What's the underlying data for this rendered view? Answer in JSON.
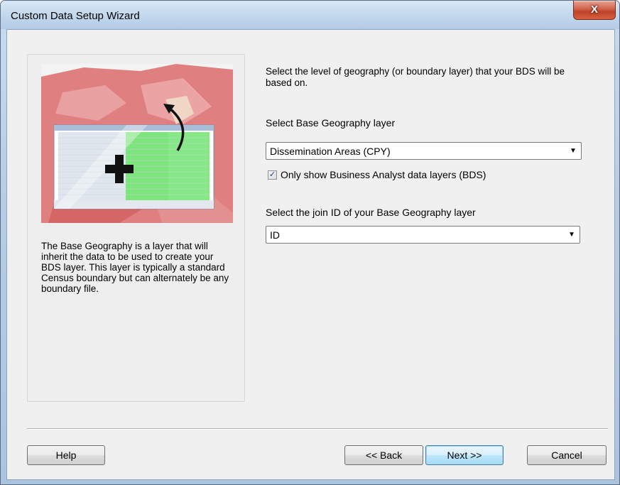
{
  "window": {
    "title": "Custom Data Setup Wizard",
    "close_label": "X"
  },
  "left_panel": {
    "description": "The Base Geography is a layer that will inherit the data to be used to create your BDS layer. This layer is typically a standard Census boundary but can alternately be any boundary file."
  },
  "main": {
    "intro": "Select the level of geography (or boundary layer) that your BDS will be based on.",
    "base_geography_label": "Select Base Geography layer",
    "base_geography_value": "Dissemination Areas (CPY)",
    "only_bds_label": "Only show Business Analyst data layers (BDS)",
    "only_bds_checked": true,
    "join_id_label": "Select the join ID of your Base Geography layer",
    "join_id_value": "ID"
  },
  "buttons": {
    "help": "Help",
    "back": "<< Back",
    "next": "Next >>",
    "cancel": "Cancel"
  },
  "icons": {
    "dropdown": "chevron-down-icon",
    "checkmark": "checkmark-icon",
    "close": "close-icon"
  },
  "colors": {
    "close_button": "#c0422a",
    "default_button_border": "#3c7fb1",
    "table_highlight": "#7de57d"
  }
}
